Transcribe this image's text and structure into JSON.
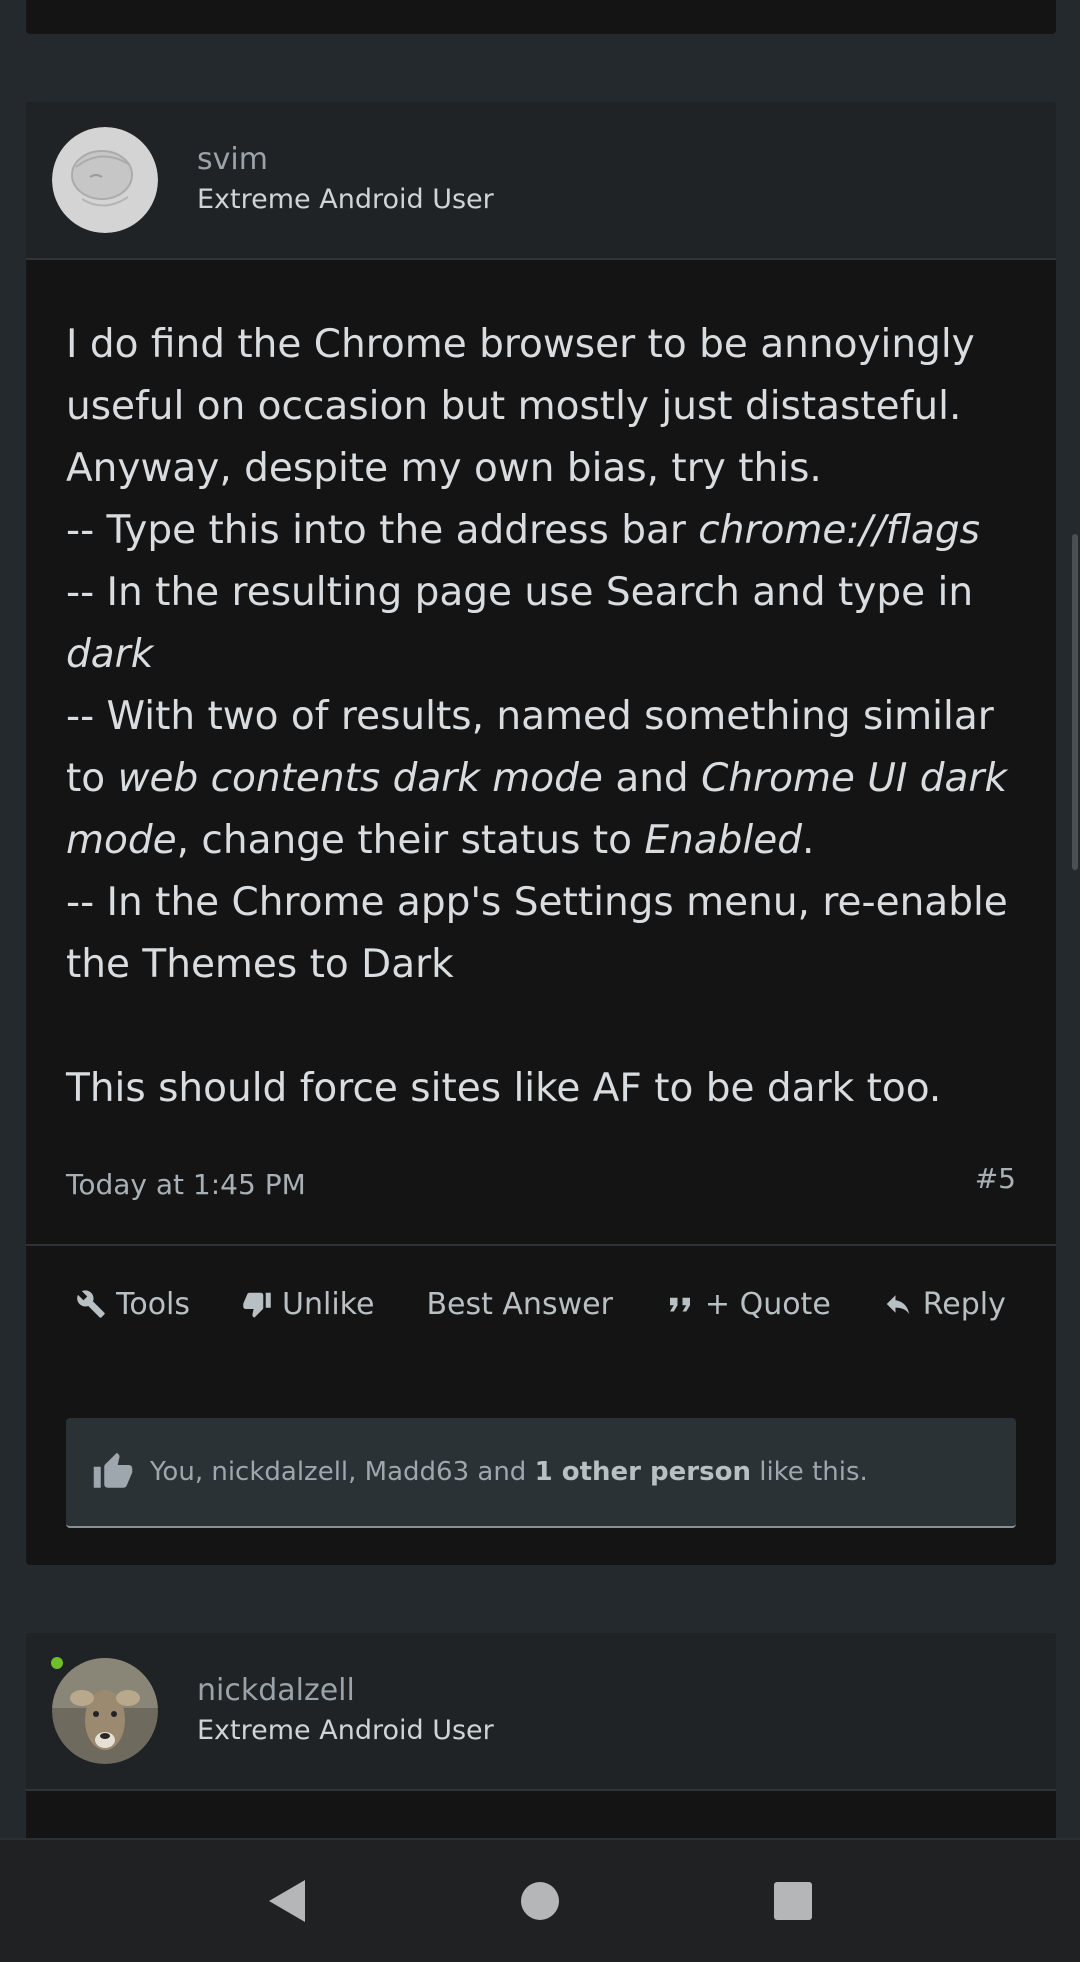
{
  "post1": {
    "username": "svim",
    "user_title": "Extreme Android User",
    "body": {
      "l1": "I do find the Chrome browser to be annoyingly",
      "l2": "useful on occasion but mostly just distasteful.",
      "l3": "Anyway, despite my own bias, try this.",
      "l4_a": "-- Type this into the address bar ",
      "l4_b": "chrome://flags",
      "l5": "-- In the resulting page use Search and type in",
      "l6": "dark",
      "l7": "-- With two of results, named something similar",
      "l8_a": "to ",
      "l8_b": "web contents dark mode",
      "l8_c": " and ",
      "l8_d": "Chrome UI dark",
      "l9_a": "mode",
      "l9_b": ", change their status to ",
      "l9_c": "Enabled",
      "l9_d": ".",
      "l10": "-- In the Chrome app's Settings menu, re-enable",
      "l11": "the Themes to Dark",
      "l12": "This should force sites like AF to be dark too."
    },
    "timestamp": "Today at 1:45 PM",
    "post_number": "#5",
    "actions": {
      "tools": "Tools",
      "unlike": "Unlike",
      "best_answer": "Best Answer",
      "quote": "+ Quote",
      "reply": "Reply"
    },
    "likes": {
      "prefix": "You, nickdalzell, Madd63 and ",
      "bold": "1 other person",
      "suffix": " like this."
    }
  },
  "post2": {
    "username": "nickdalzell",
    "user_title": "Extreme Android User",
    "online": true
  },
  "colors": {
    "background": "#24292d",
    "post_bg": "#141414",
    "header_bg": "#202325",
    "online": "#6fbf2a"
  },
  "icons": [
    "wrench-icon",
    "thumbs-down-icon",
    "quote-icon",
    "reply-icon",
    "thumbs-up-icon",
    "back-icon",
    "home-icon",
    "recents-icon"
  ]
}
